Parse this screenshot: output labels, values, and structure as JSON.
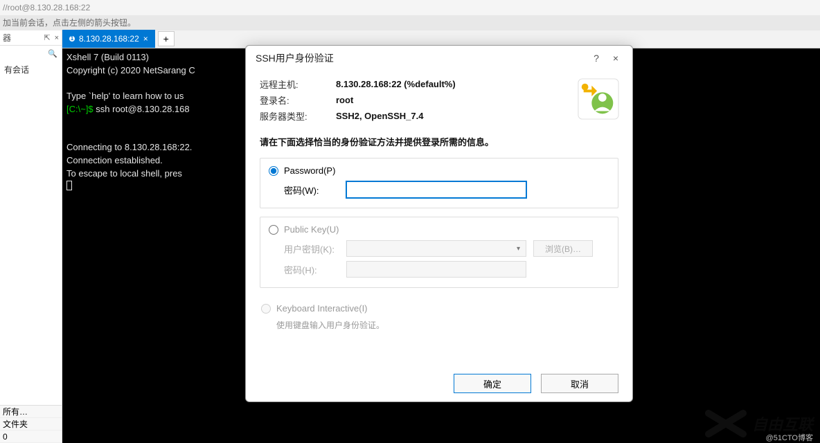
{
  "titlebar": "//root@8.130.28.168:22",
  "helper_text": "加当前会话，点击左侧的箭头按钮。",
  "left": {
    "toolbar_label": "器",
    "pin": "⇱",
    "close": "×",
    "body": "有会话",
    "bottom": {
      "all": "所有…",
      "folder": "文件夹",
      "count": "0"
    }
  },
  "tab": {
    "index": "1",
    "label": "8.130.28.168:22",
    "close": "×",
    "add": "+"
  },
  "terminal": {
    "l1": "Xshell 7 (Build 0113)",
    "l2": "Copyright (c) 2020 NetSarang C",
    "l3": "Type `help' to learn how to us",
    "prompt": "[C:\\~]$ ",
    "cmd": "ssh root@8.130.28.168",
    "l5": "Connecting to 8.130.28.168:22.",
    "l6": "Connection established.",
    "l7": "To escape to local shell, pres"
  },
  "dialog": {
    "title": "SSH用户身份验证",
    "help": "?",
    "close": "×",
    "info": {
      "host_label": "远程主机:",
      "host_value": "8.130.28.168:22 (%default%)",
      "login_label": "登录名:",
      "login_value": "root",
      "type_label": "服务器类型:",
      "type_value": "SSH2, OpenSSH_7.4"
    },
    "instruction": "请在下面选择恰当的身份验证方法并提供登录所需的信息。",
    "password": {
      "radio": "Password(P)",
      "pwd_label": "密码(W):"
    },
    "publickey": {
      "radio": "Public Key(U)",
      "key_label": "用户密钥(K):",
      "pwd_label": "密码(H):",
      "browse": "浏览(B)…"
    },
    "ki": {
      "radio": "Keyboard Interactive(I)",
      "hint": "使用键盘输入用户身份验证。"
    },
    "buttons": {
      "ok": "确定",
      "cancel": "取消"
    }
  },
  "watermark": "自由互联",
  "caption": "@51CTO博客"
}
